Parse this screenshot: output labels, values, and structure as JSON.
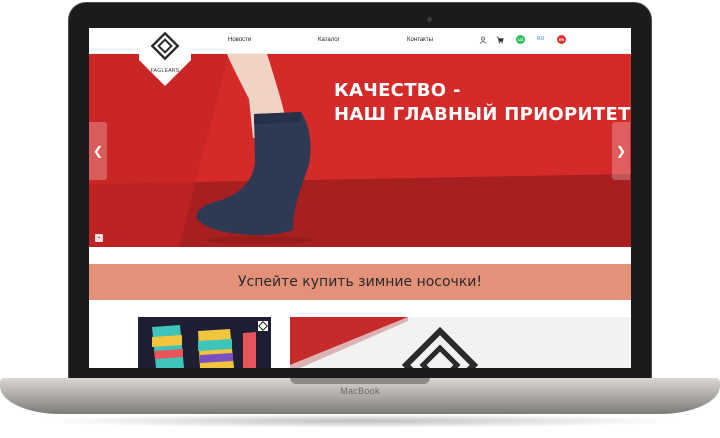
{
  "device": {
    "label": "MacBook"
  },
  "header": {
    "logo_text": "FAGLEARS",
    "nav": [
      "Новости",
      "Каталог",
      "Контакты"
    ],
    "languages": [
      {
        "code": "UZ",
        "color": "#2ebd59"
      },
      {
        "code": "RU",
        "color": "#3b7dd8"
      },
      {
        "code": "EN",
        "color": "#e0312f"
      }
    ]
  },
  "hero": {
    "headline_line1": "КАЧЕСТВО -",
    "headline_line2": "НАШ ГЛАВНЫЙ ПРИОРИТЕТ",
    "prev_arrow": "❮",
    "next_arrow": "❯",
    "accent_color": "#d42a2a"
  },
  "promo": {
    "text": "Успейте купить зимние носочки!",
    "color": "#e49179"
  }
}
